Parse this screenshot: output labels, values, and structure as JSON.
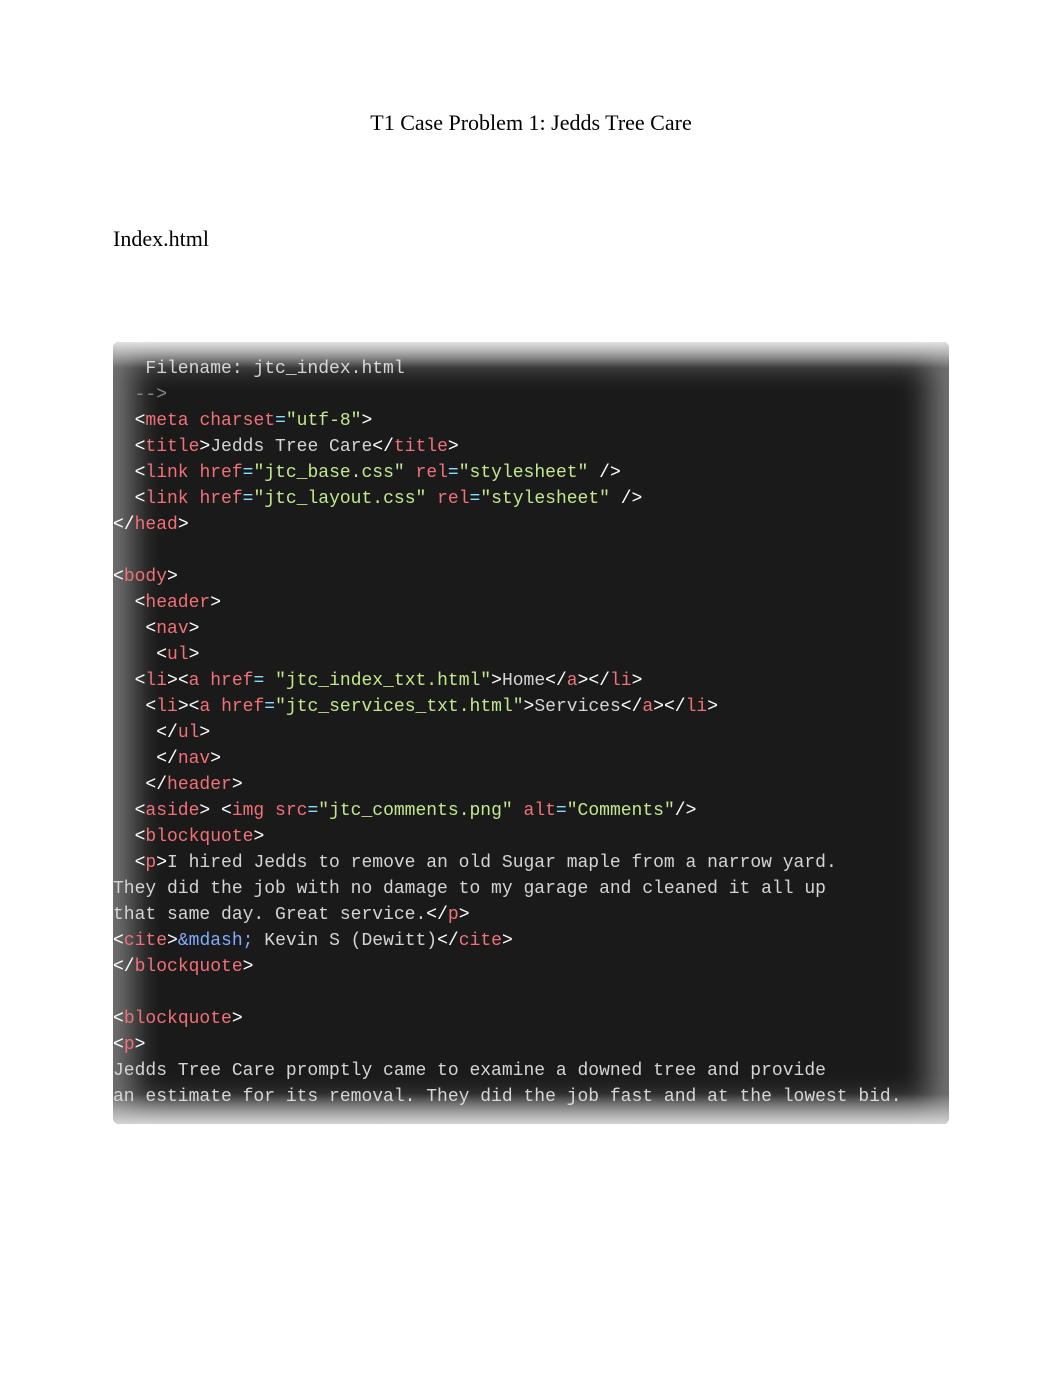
{
  "title": "T1 Case Problem 1: Jedds Tree Care",
  "section_label": "Index.html",
  "code_lines": [
    [
      {
        "text": "   Filename: jtc_index.html",
        "cls": "t-text"
      }
    ],
    [
      {
        "text": "  -->",
        "cls": "t-comment"
      }
    ],
    [
      {
        "text": "  <",
        "cls": "t-white"
      },
      {
        "text": "meta",
        "cls": "t-tag"
      },
      {
        "text": " ",
        "cls": "t-white"
      },
      {
        "text": "charset",
        "cls": "t-tag"
      },
      {
        "text": "=",
        "cls": "t-punct"
      },
      {
        "text": "\"utf-8\"",
        "cls": "t-str"
      },
      {
        "text": ">",
        "cls": "t-white"
      }
    ],
    [
      {
        "text": "  <",
        "cls": "t-white"
      },
      {
        "text": "title",
        "cls": "t-tag"
      },
      {
        "text": ">",
        "cls": "t-white"
      },
      {
        "text": "Jedds Tree Care",
        "cls": "t-text"
      },
      {
        "text": "</",
        "cls": "t-white"
      },
      {
        "text": "title",
        "cls": "t-tag"
      },
      {
        "text": ">",
        "cls": "t-white"
      }
    ],
    [
      {
        "text": "  <",
        "cls": "t-white"
      },
      {
        "text": "link",
        "cls": "t-tag"
      },
      {
        "text": " ",
        "cls": "t-white"
      },
      {
        "text": "href",
        "cls": "t-tag"
      },
      {
        "text": "=",
        "cls": "t-punct"
      },
      {
        "text": "\"jtc_base.css\"",
        "cls": "t-str"
      },
      {
        "text": " ",
        "cls": "t-white"
      },
      {
        "text": "rel",
        "cls": "t-tag"
      },
      {
        "text": "=",
        "cls": "t-punct"
      },
      {
        "text": "\"stylesheet\"",
        "cls": "t-str"
      },
      {
        "text": " />",
        "cls": "t-white"
      }
    ],
    [
      {
        "text": "  <",
        "cls": "t-white"
      },
      {
        "text": "link",
        "cls": "t-tag"
      },
      {
        "text": " ",
        "cls": "t-white"
      },
      {
        "text": "href",
        "cls": "t-tag"
      },
      {
        "text": "=",
        "cls": "t-punct"
      },
      {
        "text": "\"jtc_layout.css\"",
        "cls": "t-str"
      },
      {
        "text": " ",
        "cls": "t-white"
      },
      {
        "text": "rel",
        "cls": "t-tag"
      },
      {
        "text": "=",
        "cls": "t-punct"
      },
      {
        "text": "\"stylesheet\"",
        "cls": "t-str"
      },
      {
        "text": " />",
        "cls": "t-white"
      }
    ],
    [
      {
        "text": "</",
        "cls": "t-white"
      },
      {
        "text": "head",
        "cls": "t-tag"
      },
      {
        "text": ">",
        "cls": "t-white"
      }
    ],
    [
      {
        "text": "",
        "cls": "t-text"
      }
    ],
    [
      {
        "text": "<",
        "cls": "t-white"
      },
      {
        "text": "body",
        "cls": "t-tag"
      },
      {
        "text": ">",
        "cls": "t-white"
      }
    ],
    [
      {
        "text": "  <",
        "cls": "t-white"
      },
      {
        "text": "header",
        "cls": "t-tag"
      },
      {
        "text": ">",
        "cls": "t-white"
      }
    ],
    [
      {
        "text": "   <",
        "cls": "t-white"
      },
      {
        "text": "nav",
        "cls": "t-tag"
      },
      {
        "text": ">",
        "cls": "t-white"
      }
    ],
    [
      {
        "text": "    <",
        "cls": "t-white"
      },
      {
        "text": "ul",
        "cls": "t-tag"
      },
      {
        "text": ">",
        "cls": "t-white"
      }
    ],
    [
      {
        "text": "  <",
        "cls": "t-white"
      },
      {
        "text": "li",
        "cls": "t-tag"
      },
      {
        "text": "><",
        "cls": "t-white"
      },
      {
        "text": "a",
        "cls": "t-tag"
      },
      {
        "text": " ",
        "cls": "t-white"
      },
      {
        "text": "href",
        "cls": "t-tag"
      },
      {
        "text": "= ",
        "cls": "t-punct"
      },
      {
        "text": "\"jtc_index_txt.html\"",
        "cls": "t-str"
      },
      {
        "text": ">",
        "cls": "t-white"
      },
      {
        "text": "Home",
        "cls": "t-text"
      },
      {
        "text": "</",
        "cls": "t-white"
      },
      {
        "text": "a",
        "cls": "t-tag"
      },
      {
        "text": "></",
        "cls": "t-white"
      },
      {
        "text": "li",
        "cls": "t-tag"
      },
      {
        "text": ">",
        "cls": "t-white"
      }
    ],
    [
      {
        "text": "   <",
        "cls": "t-white"
      },
      {
        "text": "li",
        "cls": "t-tag"
      },
      {
        "text": "><",
        "cls": "t-white"
      },
      {
        "text": "a",
        "cls": "t-tag"
      },
      {
        "text": " ",
        "cls": "t-white"
      },
      {
        "text": "href",
        "cls": "t-tag"
      },
      {
        "text": "=",
        "cls": "t-punct"
      },
      {
        "text": "\"jtc_services_txt.html\"",
        "cls": "t-str"
      },
      {
        "text": ">",
        "cls": "t-white"
      },
      {
        "text": "Services",
        "cls": "t-text"
      },
      {
        "text": "</",
        "cls": "t-white"
      },
      {
        "text": "a",
        "cls": "t-tag"
      },
      {
        "text": "></",
        "cls": "t-white"
      },
      {
        "text": "li",
        "cls": "t-tag"
      },
      {
        "text": ">",
        "cls": "t-white"
      }
    ],
    [
      {
        "text": "    </",
        "cls": "t-white"
      },
      {
        "text": "ul",
        "cls": "t-tag"
      },
      {
        "text": ">",
        "cls": "t-white"
      }
    ],
    [
      {
        "text": "    </",
        "cls": "t-white"
      },
      {
        "text": "nav",
        "cls": "t-tag"
      },
      {
        "text": ">",
        "cls": "t-white"
      }
    ],
    [
      {
        "text": "   </",
        "cls": "t-white"
      },
      {
        "text": "header",
        "cls": "t-tag"
      },
      {
        "text": ">",
        "cls": "t-white"
      }
    ],
    [
      {
        "text": "  <",
        "cls": "t-white"
      },
      {
        "text": "aside",
        "cls": "t-tag"
      },
      {
        "text": "> <",
        "cls": "t-white"
      },
      {
        "text": "img",
        "cls": "t-tag"
      },
      {
        "text": " ",
        "cls": "t-white"
      },
      {
        "text": "src",
        "cls": "t-tag"
      },
      {
        "text": "=",
        "cls": "t-punct"
      },
      {
        "text": "\"jtc_comments.png\"",
        "cls": "t-str"
      },
      {
        "text": " ",
        "cls": "t-white"
      },
      {
        "text": "alt",
        "cls": "t-tag"
      },
      {
        "text": "=",
        "cls": "t-punct"
      },
      {
        "text": "\"Comments\"",
        "cls": "t-str"
      },
      {
        "text": "/>",
        "cls": "t-white"
      }
    ],
    [
      {
        "text": "  <",
        "cls": "t-white"
      },
      {
        "text": "blockquote",
        "cls": "t-tag"
      },
      {
        "text": ">",
        "cls": "t-white"
      }
    ],
    [
      {
        "text": "  <",
        "cls": "t-white"
      },
      {
        "text": "p",
        "cls": "t-tag"
      },
      {
        "text": ">",
        "cls": "t-white"
      },
      {
        "text": "I hired Jedds to remove an old Sugar maple from a narrow yard.",
        "cls": "t-text"
      }
    ],
    [
      {
        "text": "They did the job with no damage to my garage and cleaned it all up",
        "cls": "t-text"
      }
    ],
    [
      {
        "text": "that same day. Great service.",
        "cls": "t-text"
      },
      {
        "text": "</",
        "cls": "t-white"
      },
      {
        "text": "p",
        "cls": "t-tag"
      },
      {
        "text": ">",
        "cls": "t-white"
      }
    ],
    [
      {
        "text": "<",
        "cls": "t-white"
      },
      {
        "text": "cite",
        "cls": "t-tag"
      },
      {
        "text": ">",
        "cls": "t-white"
      },
      {
        "text": "&mdash;",
        "cls": "t-entity"
      },
      {
        "text": " Kevin S (Dewitt)",
        "cls": "t-text"
      },
      {
        "text": "</",
        "cls": "t-white"
      },
      {
        "text": "cite",
        "cls": "t-tag"
      },
      {
        "text": ">",
        "cls": "t-white"
      }
    ],
    [
      {
        "text": "</",
        "cls": "t-white"
      },
      {
        "text": "blockquote",
        "cls": "t-tag"
      },
      {
        "text": ">",
        "cls": "t-white"
      }
    ],
    [
      {
        "text": "",
        "cls": "t-text"
      }
    ],
    [
      {
        "text": "<",
        "cls": "t-white"
      },
      {
        "text": "blockquote",
        "cls": "t-tag"
      },
      {
        "text": ">",
        "cls": "t-white"
      }
    ],
    [
      {
        "text": "<",
        "cls": "t-white"
      },
      {
        "text": "p",
        "cls": "t-tag"
      },
      {
        "text": ">",
        "cls": "t-white"
      }
    ],
    [
      {
        "text": "Jedds Tree Care promptly came to examine a downed tree and provide",
        "cls": "t-text"
      }
    ],
    [
      {
        "text": "an estimate for its removal. They did the job fast and at the lowest bid.",
        "cls": "t-text"
      }
    ]
  ]
}
